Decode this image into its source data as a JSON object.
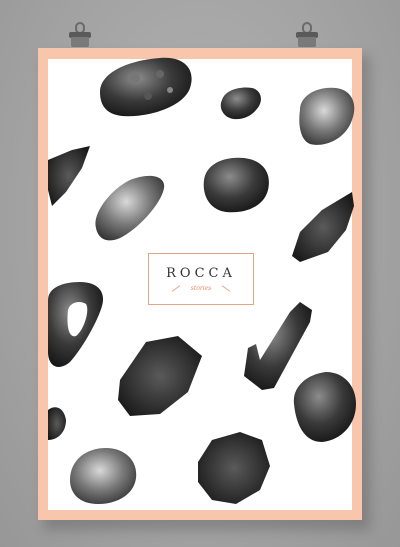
{
  "poster": {
    "title": "ROCCA",
    "subtitle": "stories"
  },
  "colors": {
    "wall": "#a6a6a6",
    "frame": "#f7c6ac",
    "paper": "#ffffff",
    "accent": "#e08a66",
    "stone": "#2f2f2f"
  }
}
